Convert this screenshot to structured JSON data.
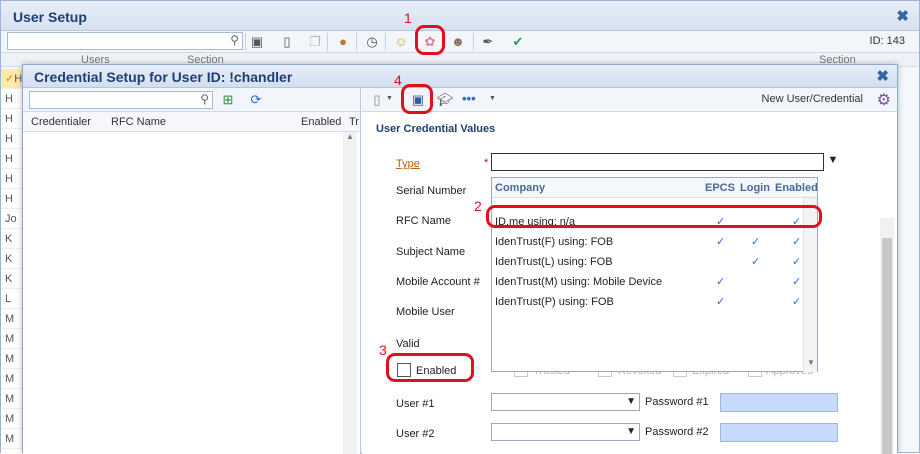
{
  "outer": {
    "title": "User Setup",
    "id_label": "ID: 143",
    "col_users": "Users",
    "col_section": "Section",
    "col_section2": "Section",
    "left_letters": [
      "H",
      "H",
      "H",
      "H",
      "H",
      "H",
      "H",
      "Jo",
      "K",
      "K",
      "K",
      "L",
      "M",
      "M",
      "M",
      "M",
      "M",
      "M",
      "M",
      "M"
    ]
  },
  "inner": {
    "title": "Credential Setup for User ID: !chandler",
    "left": {
      "headers": [
        "Credentialer",
        "RFC Name",
        "Enabled",
        "Tr"
      ]
    },
    "right": {
      "new_user_label": "New User/Credential",
      "section_title": "User Credential Values",
      "type_label": "Type",
      "required_mark": "*",
      "serial_label": "Serial Number",
      "rfc_label": "RFC Name",
      "subject_label": "Subject Name",
      "mobile_account_label": "Mobile Account #",
      "mobile_user_label": "Mobile User",
      "valid_label": "Valid",
      "enabled_label": "Enabled",
      "trusted_label": "Trusted",
      "revoked_label": "Revoked",
      "expired_label": "Expired",
      "approved_label": "Approved",
      "user1_label": "User #1",
      "user2_label": "User #2",
      "password1_label": "Password #1",
      "password2_label": "Password #2"
    },
    "dropdown": {
      "headers": [
        "Company",
        "EPCS",
        "Login",
        "Enabled"
      ],
      "rows": [
        {
          "company": "ID.me using: n/a",
          "epcs": "✓",
          "login": "",
          "enabled": "✓"
        },
        {
          "company": "IdenTrust(F) using: FOB",
          "epcs": "✓",
          "login": "✓",
          "enabled": "✓"
        },
        {
          "company": "IdenTrust(L) using: FOB",
          "epcs": "",
          "login": "✓",
          "enabled": "✓"
        },
        {
          "company": "IdenTrust(M) using: Mobile Device",
          "epcs": "✓",
          "login": "",
          "enabled": "✓"
        },
        {
          "company": "IdenTrust(P) using: FOB",
          "epcs": "✓",
          "login": "",
          "enabled": "✓"
        }
      ]
    }
  },
  "annotations": {
    "n1": "1",
    "n2": "2",
    "n3": "3",
    "n4": "4"
  }
}
